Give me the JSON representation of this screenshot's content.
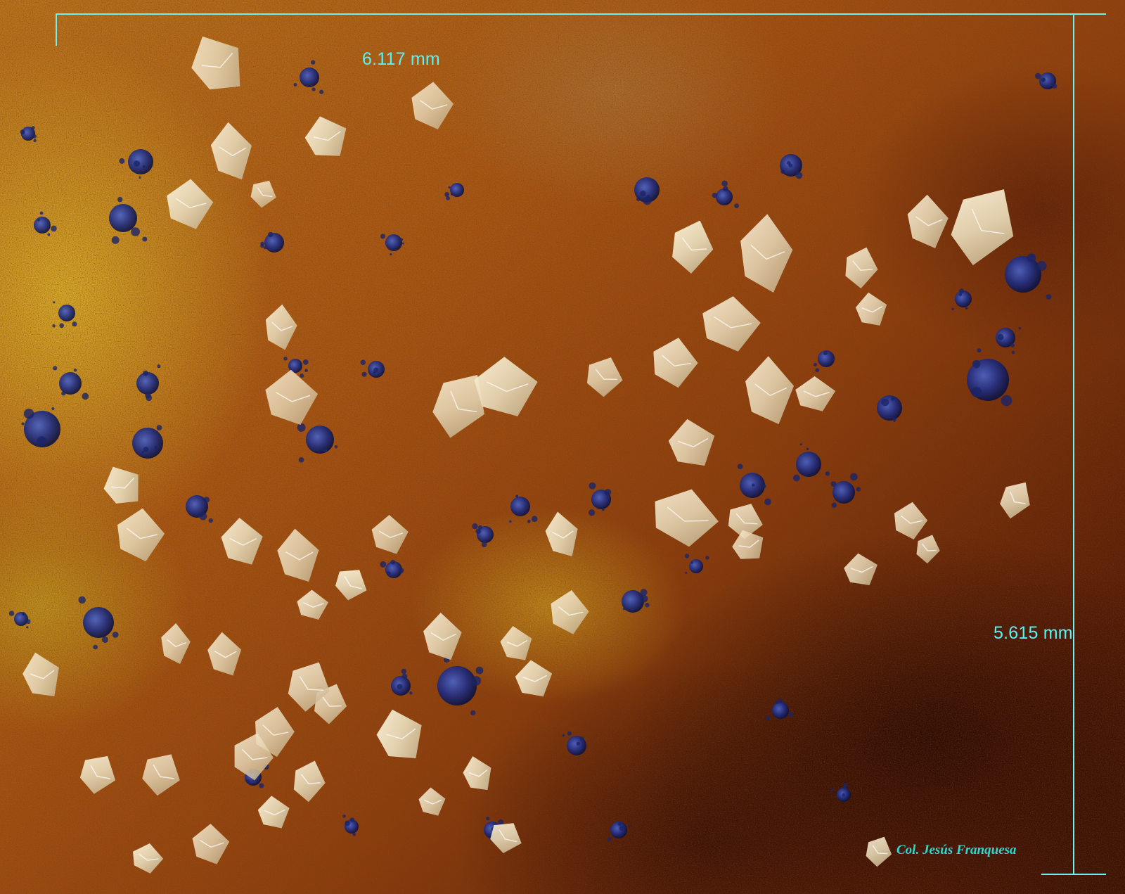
{
  "scale_bars": {
    "horizontal_label": "6.117 mm",
    "vertical_label": "5.615 mm"
  },
  "credit": "Col. Jesús Franquesa",
  "colors": {
    "scale_line": "#6ff0f0",
    "scale_text": "#59f2f2",
    "credit_text": "#2fd9cf",
    "crystal": "#e8dcc0",
    "blue_mineral": "#1c2a78"
  }
}
